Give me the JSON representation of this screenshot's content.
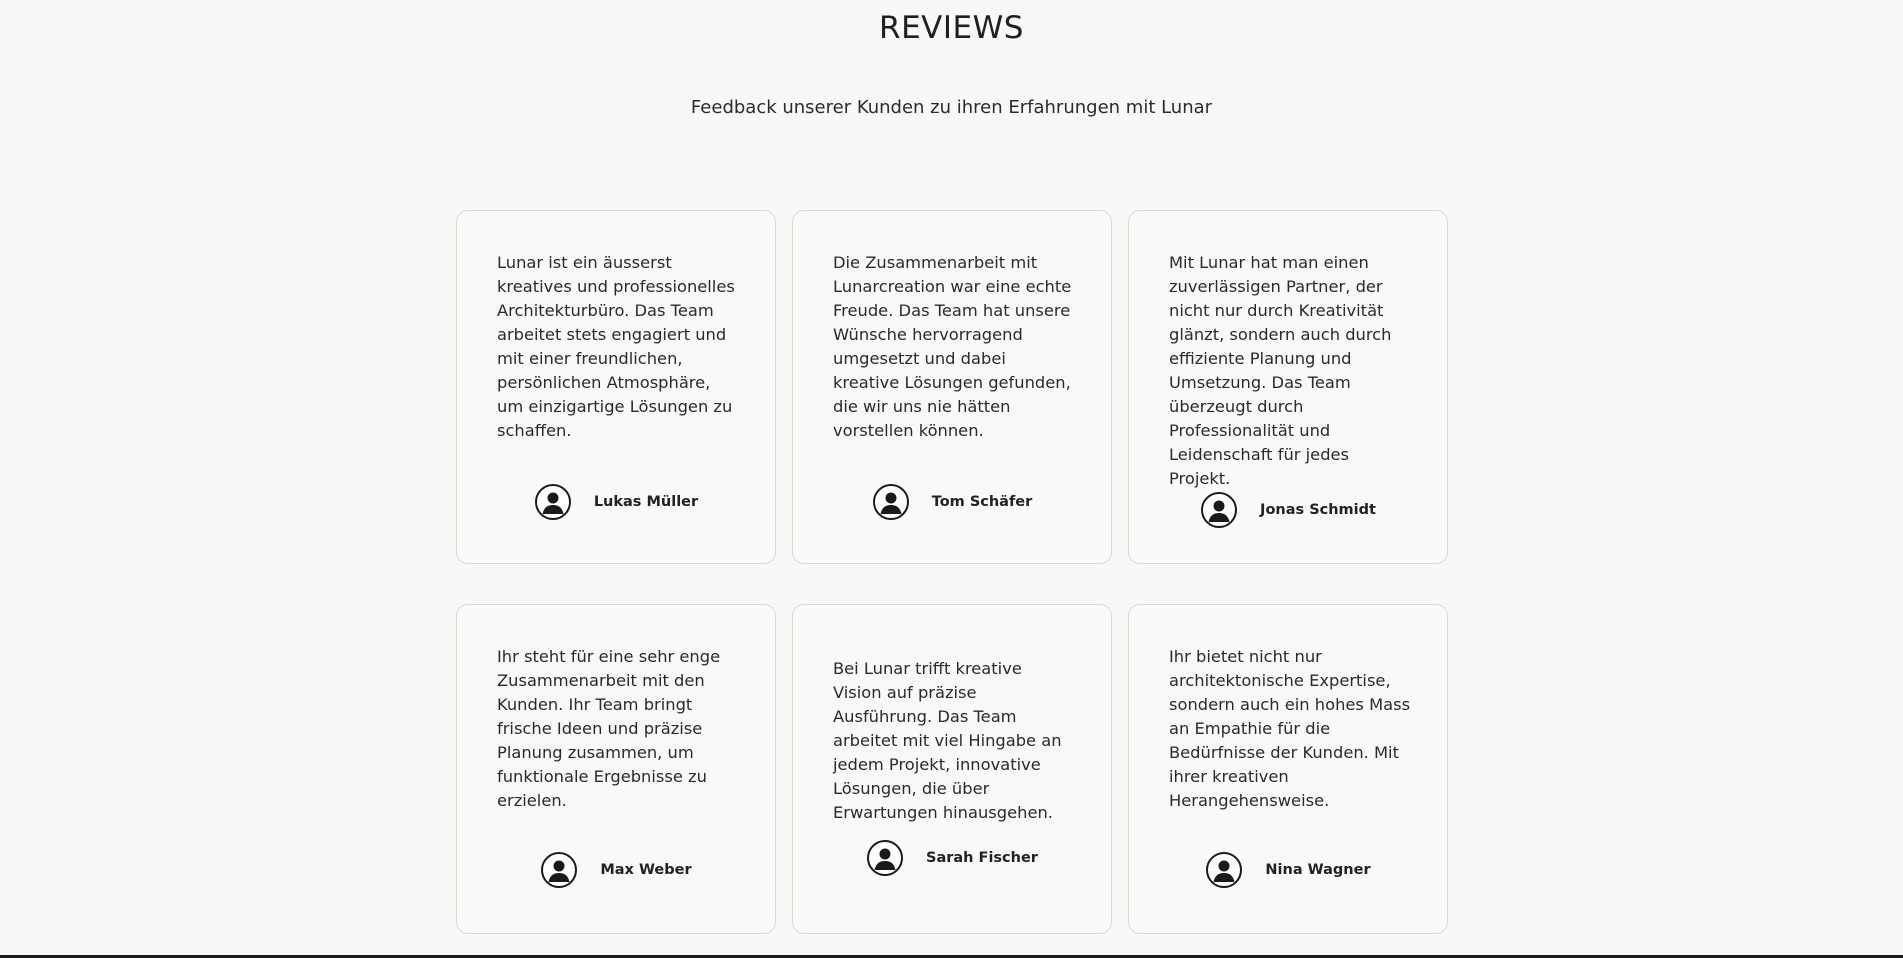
{
  "section": {
    "title": "REVIEWS",
    "subtitle": "Feedback unserer Kunden zu ihren Erfahrungen mit Lunar"
  },
  "reviews": [
    {
      "text": "Lunar ist ein äusserst kreatives und professionelles Architekturbüro. Das Team arbeitet stets engagiert und mit einer freundlichen, persönlichen Atmosphäre, um einzigartige Lösungen zu schaffen.",
      "author": "Lukas Müller",
      "icon": "user-avatar-icon"
    },
    {
      "text": "Die Zusammenarbeit mit Lunarcreation war eine echte Freude. Das Team hat unsere Wünsche hervorragend umgesetzt und dabei kreative Lösungen gefunden, die wir uns nie hätten vorstellen können.",
      "author": "Tom Schäfer",
      "icon": "user-avatar-icon"
    },
    {
      "text": "Mit Lunar hat man einen zuverlässigen Partner, der nicht nur durch Kreativität glänzt, sondern auch durch effiziente Planung und Umsetzung. Das Team überzeugt durch Professionalität und Leidenschaft für jedes Projekt.",
      "author": "Jonas Schmidt",
      "icon": "user-avatar-icon"
    },
    {
      "text": "Ihr steht für eine sehr enge Zusammenarbeit mit den Kunden. Ihr Team bringt frische Ideen und präzise Planung zusammen, um funktionale Ergebnisse zu erzielen.",
      "author": "Max Weber",
      "icon": "user-avatar-icon"
    },
    {
      "text": "Bei Lunar trifft kreative Vision auf präzise Ausführung. Das Team arbeitet mit viel Hingabe an jedem Projekt, innovative Lösungen, die über Erwartungen hinausgehen.",
      "author": "Sarah Fischer",
      "icon": "user-avatar-icon"
    },
    {
      "text": "Ihr bietet nicht nur architektonische Expertise, sondern auch ein hohes Mass an Empathie für die Bedürfnisse der Kunden. Mit ihrer kreativen Herangehensweise.",
      "author": "Nina Wagner",
      "icon": "user-avatar-icon"
    }
  ]
}
